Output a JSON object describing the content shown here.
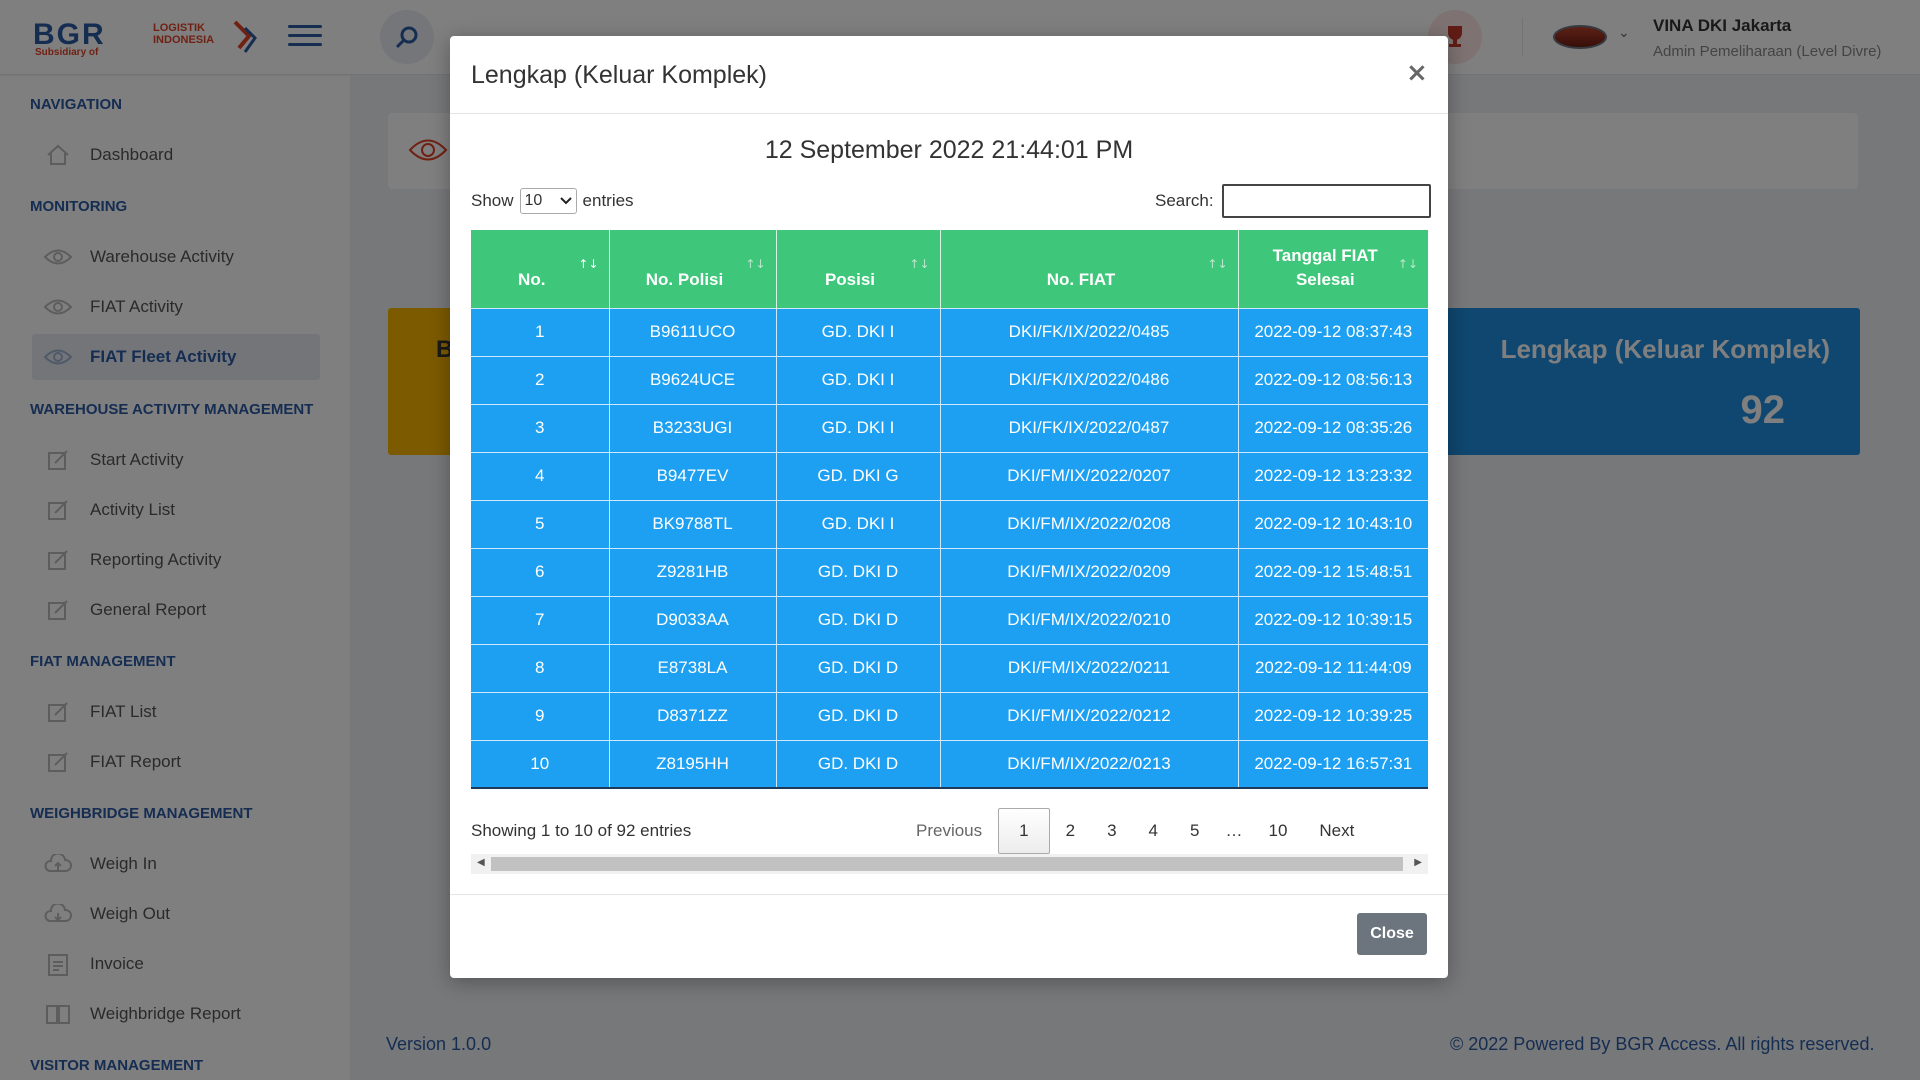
{
  "header": {
    "logo_main": "BGR",
    "logo_line1": "LOGISTIK",
    "logo_line2": "INDONESIA",
    "logo_sub": "Subsidiary of",
    "user_name": "VINA DKI Jakarta",
    "user_role": "Admin Pemeliharaan (Level Divre)"
  },
  "sidebar": {
    "sections": [
      {
        "title": "NAVIGATION",
        "items": [
          {
            "label": "Dashboard",
            "icon": "home-icon"
          }
        ]
      },
      {
        "title": "MONITORING",
        "items": [
          {
            "label": "Warehouse Activity",
            "icon": "eye-icon"
          },
          {
            "label": "FIAT Activity",
            "icon": "eye-icon"
          },
          {
            "label": "FIAT Fleet Activity",
            "icon": "eye-icon",
            "active": true
          }
        ]
      },
      {
        "title": "WAREHOUSE ACTIVITY MANAGEMENT",
        "items": [
          {
            "label": "Start Activity",
            "icon": "edit-icon"
          },
          {
            "label": "Activity List",
            "icon": "edit-icon"
          },
          {
            "label": "Reporting Activity",
            "icon": "edit-icon"
          },
          {
            "label": "General Report",
            "icon": "edit-icon"
          }
        ]
      },
      {
        "title": "FIAT MANAGEMENT",
        "items": [
          {
            "label": "FIAT List",
            "icon": "edit-icon"
          },
          {
            "label": "FIAT Report",
            "icon": "edit-icon"
          }
        ]
      },
      {
        "title": "WEIGHBRIDGE MANAGEMENT",
        "items": [
          {
            "label": "Weigh In",
            "icon": "cloud-upload-icon"
          },
          {
            "label": "Weigh Out",
            "icon": "cloud-download-icon"
          },
          {
            "label": "Invoice",
            "icon": "clipboard-icon"
          },
          {
            "label": "Weighbridge Report",
            "icon": "book-icon"
          }
        ]
      },
      {
        "title": "VISITOR MANAGEMENT",
        "items": []
      }
    ]
  },
  "main": {
    "stat_left_letter": "B",
    "stat_right_title": "Lengkap (Keluar Komplek)",
    "stat_right_count": "92",
    "footer_version": "Version 1.0.0",
    "footer_copy": "© 2022 Powered By BGR Access. All rights reserved."
  },
  "modal": {
    "title": "Lengkap (Keluar Komplek)",
    "close_symbol": "×",
    "date": "12 September 2022 21:44:01 PM",
    "show_label": "Show",
    "entries_label": "entries",
    "page_length": "10",
    "search_label": "Search:",
    "search_value": "",
    "columns": [
      "No.",
      "No. Polisi",
      "Posisi",
      "No. FIAT",
      "Tanggal FIAT Selesai"
    ],
    "rows": [
      [
        "1",
        "B9611UCO",
        "GD. DKI I",
        "DKI/FK/IX/2022/0485",
        "2022-09-12 08:37:43"
      ],
      [
        "2",
        "B9624UCE",
        "GD. DKI I",
        "DKI/FK/IX/2022/0486",
        "2022-09-12 08:56:13"
      ],
      [
        "3",
        "B3233UGI",
        "GD. DKI I",
        "DKI/FK/IX/2022/0487",
        "2022-09-12 08:35:26"
      ],
      [
        "4",
        "B9477EV",
        "GD. DKI G",
        "DKI/FM/IX/2022/0207",
        "2022-09-12 13:23:32"
      ],
      [
        "5",
        "BK9788TL",
        "GD. DKI I",
        "DKI/FM/IX/2022/0208",
        "2022-09-12 10:43:10"
      ],
      [
        "6",
        "Z9281HB",
        "GD. DKI D",
        "DKI/FM/IX/2022/0209",
        "2022-09-12 15:48:51"
      ],
      [
        "7",
        "D9033AA",
        "GD. DKI D",
        "DKI/FM/IX/2022/0210",
        "2022-09-12 10:39:15"
      ],
      [
        "8",
        "E8738LA",
        "GD. DKI D",
        "DKI/FM/IX/2022/0211",
        "2022-09-12 11:44:09"
      ],
      [
        "9",
        "D8371ZZ",
        "GD. DKI D",
        "DKI/FM/IX/2022/0212",
        "2022-09-12 10:39:25"
      ],
      [
        "10",
        "Z8195HH",
        "GD. DKI D",
        "DKI/FM/IX/2022/0213",
        "2022-09-12 16:57:31"
      ]
    ],
    "info": "Showing 1 to 10 of 92 entries",
    "pager": {
      "previous": "Previous",
      "pages": [
        "1",
        "2",
        "3",
        "4",
        "5"
      ],
      "ellipsis": "…",
      "last": "10",
      "next": "Next",
      "current": "1"
    },
    "close_button": "Close"
  },
  "colors": {
    "brand": "#2c5aa5",
    "header_green": "#3ec77a",
    "row_blue": "#1da0f2",
    "stat_yellow": "#f7b500",
    "stat_blue": "#1e8ee0",
    "close_gray": "#6c757d"
  }
}
